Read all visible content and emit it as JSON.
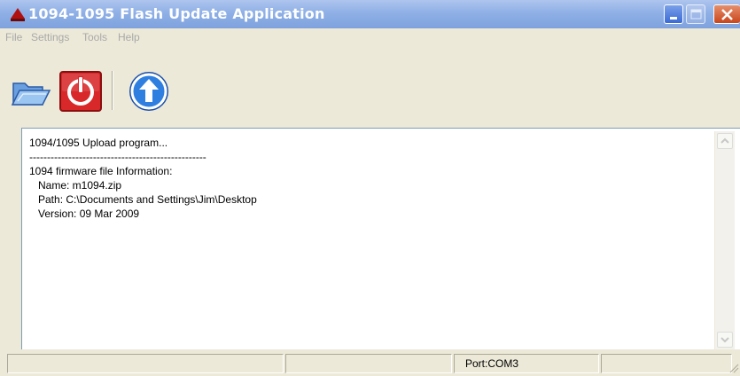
{
  "window": {
    "title": "1094-1095 Flash Update Application",
    "buttons": {
      "minimize": "minimize",
      "maximize": "maximize",
      "close": "close"
    }
  },
  "menu": [
    {
      "label": "File"
    },
    {
      "label": "Settings"
    },
    {
      "label": "Tools"
    },
    {
      "label": "Help"
    }
  ],
  "toolbar": {
    "items": [
      {
        "icon": "open-folder-icon",
        "action": "open"
      },
      {
        "icon": "power-icon",
        "action": "power"
      },
      {
        "icon": "upload-arrow-icon",
        "action": "upload"
      }
    ]
  },
  "log": {
    "lines": [
      "1094/1095 Upload program...",
      "--------------------------------------------------",
      "1094 firmware file Information:",
      "   Name: m1094.zip",
      "   Path: C:\\Documents and Settings\\Jim\\Desktop",
      "   Version: 09 Mar 2009"
    ]
  },
  "statusbar": {
    "cells": [
      "",
      "",
      "Port:COM3",
      ""
    ]
  },
  "colors": {
    "titlebar": "#8fb0e6",
    "window_bg": "#ece9d8",
    "power_red": "#d8282a",
    "upload_blue": "#2f7fe0"
  }
}
